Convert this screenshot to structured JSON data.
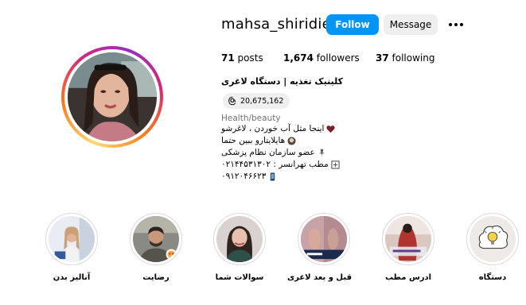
{
  "profile": {
    "username": "mahsa_shiridiet",
    "follow_label": "Follow",
    "message_label": "Message",
    "full_name": "کلینیک تغذیه | دستگاه لاغری",
    "threads_count": "20,675,162",
    "category": "Health/beauty"
  },
  "stats": {
    "posts_count": "71",
    "posts_label": "posts",
    "followers_count": "1,674",
    "followers_label": "followers",
    "following_count": "37",
    "following_label": "following"
  },
  "bio": [
    "اینجا مثل آب خوردن ، لاغرشو",
    "هایلایتارو ببین حتما",
    "عضو سازمان نظام پزشکی",
    "مطب تهرانسر : ۰۲۱۴۴۵۳۱۳۰۲",
    "۰۹۱۲۰۴۶۶۲۳"
  ],
  "highlights": [
    {
      "label": "آنالیز بدن"
    },
    {
      "label": "رضایت"
    },
    {
      "label": "سوالات شما"
    },
    {
      "label": "قبل و بعد لاغری"
    },
    {
      "label": "ادرس مطب"
    },
    {
      "label": "دستگاه"
    }
  ],
  "colors": {
    "follow_button": "#0095f6",
    "message_button": "#efefef",
    "secondary_text": "#737373"
  },
  "icons": {
    "more": "more-options-icon",
    "threads": "threads-icon"
  }
}
